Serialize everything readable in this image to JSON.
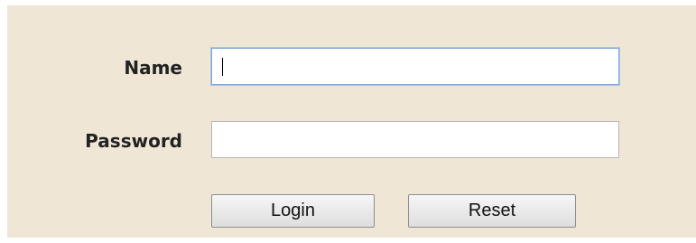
{
  "form": {
    "name_label": "Name",
    "name_value": "",
    "password_label": "Password",
    "password_value": "",
    "login_label": "Login",
    "reset_label": "Reset"
  },
  "colors": {
    "panel_background": "#efe6d6",
    "focus_border": "#7fa7d9"
  }
}
